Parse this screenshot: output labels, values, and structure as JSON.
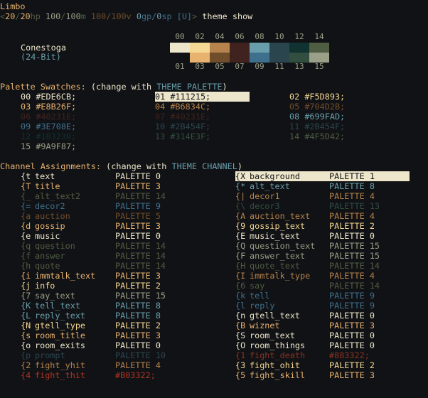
{
  "header": {
    "zone": "Limbo",
    "prompt": {
      "hp": "20",
      "hp_max": "20",
      "mv": "100",
      "mv_max": "100",
      "v": "100",
      "v_max": "100",
      "gp": "0",
      "sp": "0",
      "flag": "[U]",
      "command": "theme show"
    }
  },
  "theme": {
    "name": "Conestoga",
    "depth": "(24-Bit)",
    "top_indices": [
      "00",
      "02",
      "04",
      "06",
      "08",
      "10",
      "12",
      "14"
    ],
    "bottom_indices": [
      "01",
      "03",
      "05",
      "07",
      "09",
      "11",
      "13",
      "15"
    ],
    "top_colors": [
      "#EDE6CB",
      "#F5D893",
      "#B6834C",
      "#40231E",
      "#699FAD",
      "#2B454F",
      "#103230",
      "#4F5D42"
    ],
    "bottom_colors": [
      "#111215",
      "#E8B26F",
      "#704D2B",
      "#40231E",
      "#3E708E",
      "#2B454F",
      "#314E3F",
      "#9A9F87"
    ]
  },
  "palette": {
    "heading": "Palette Swatches:",
    "hint_pre": "(change with ",
    "hint_cmd": "THEME PALETTE",
    "hint_post": ")",
    "entries": [
      {
        "idx": "00",
        "hex": "#EDE6CB;"
      },
      {
        "idx": "01",
        "hex": "#111215;"
      },
      {
        "idx": "02",
        "hex": "#F5D893;"
      },
      {
        "idx": "03",
        "hex": "#E8B26F;"
      },
      {
        "idx": "04",
        "hex": "#B6834C;"
      },
      {
        "idx": "05",
        "hex": "#704D2B;"
      },
      {
        "idx": "06",
        "hex": "#40231E;"
      },
      {
        "idx": "07",
        "hex": "#40231E;"
      },
      {
        "idx": "08",
        "hex": "#699FAD;"
      },
      {
        "idx": "09",
        "hex": "#3E708E;"
      },
      {
        "idx": "10",
        "hex": "#2B454F;"
      },
      {
        "idx": "11",
        "hex": "#2B454F;"
      },
      {
        "idx": "12",
        "hex": "#103230;"
      },
      {
        "idx": "13",
        "hex": "#314E3F;"
      },
      {
        "idx": "14",
        "hex": "#4F5D42;"
      },
      {
        "idx": "15",
        "hex": "#9A9F87;"
      }
    ]
  },
  "channels": {
    "heading": "Channel Assignments:",
    "hint_pre": "(change with ",
    "hint_cmd": "THEME CHANNEL",
    "hint_post": ")",
    "left": [
      {
        "code": "{t",
        "name": "text",
        "val": "PALETTE 0",
        "c": 0
      },
      {
        "code": "{T",
        "name": "title",
        "val": "PALETTE 3",
        "c": 3
      },
      {
        "code": "{_",
        "name": "alt_text2",
        "val": "PALETTE 14",
        "c": 14
      },
      {
        "code": "{=",
        "name": "decor2",
        "val": "PALETTE 9",
        "c": 9
      },
      {
        "code": "{a",
        "name": "auction",
        "val": "PALETTE 5",
        "c": 5
      },
      {
        "code": "{d",
        "name": "gossip",
        "val": "PALETTE 3",
        "c": 3
      },
      {
        "code": "{e",
        "name": "music",
        "val": "PALETTE 0",
        "c": 0
      },
      {
        "code": "{q",
        "name": "question",
        "val": "PALETTE 14",
        "c": 14
      },
      {
        "code": "{f",
        "name": "answer",
        "val": "PALETTE 14",
        "c": 14
      },
      {
        "code": "{h",
        "name": "quote",
        "val": "PALETTE 14",
        "c": 14
      },
      {
        "code": "{i",
        "name": "immtalk_text",
        "val": "PALETTE 3",
        "c": 3
      },
      {
        "code": "{j",
        "name": "info",
        "val": "PALETTE 2",
        "c": 2
      },
      {
        "code": "{7",
        "name": "say_text",
        "val": "PALETTE 15",
        "c": 15
      },
      {
        "code": "{K",
        "name": "tell_text",
        "val": "PALETTE 8",
        "c": 8
      },
      {
        "code": "{L",
        "name": "reply_text",
        "val": "PALETTE 8",
        "c": 8
      },
      {
        "code": "{N",
        "name": "gtell_type",
        "val": "PALETTE 2",
        "c": 2
      },
      {
        "code": "{s",
        "name": "room_title",
        "val": "PALETTE 3",
        "c": 3
      },
      {
        "code": "{o",
        "name": "room_exits",
        "val": "PALETTE 0",
        "c": 0
      },
      {
        "code": "{p",
        "name": "prompt",
        "val": "PALETTE 10",
        "c": 10
      },
      {
        "code": "{2",
        "name": "fight_yhit",
        "val": "PALETTE 4",
        "c": 4
      },
      {
        "code": "{4",
        "name": "fight_thit",
        "val": "#B03322;",
        "c": "red"
      }
    ],
    "right": [
      {
        "code": "{X",
        "name": "background",
        "val": "PALETTE 1",
        "c": "hl"
      },
      {
        "code": "{*",
        "name": "alt_text",
        "val": "PALETTE 8",
        "c": 8
      },
      {
        "code": "{|",
        "name": "decor1",
        "val": "PALETTE 4",
        "c": 4
      },
      {
        "code": "{\\",
        "name": "decor3",
        "val": "PALETTE 13",
        "c": 13
      },
      {
        "code": "{A",
        "name": "auction_text",
        "val": "PALETTE 4",
        "c": 4
      },
      {
        "code": "{9",
        "name": "gossip_text",
        "val": "PALETTE 2",
        "c": 2
      },
      {
        "code": "{E",
        "name": "music_text",
        "val": "PALETTE 0",
        "c": 0
      },
      {
        "code": "{Q",
        "name": "question_text",
        "val": "PALETTE 15",
        "c": 15
      },
      {
        "code": "{F",
        "name": "answer_text",
        "val": "PALETTE 15",
        "c": 15
      },
      {
        "code": "{H",
        "name": "quote_text",
        "val": "PALETTE 14",
        "c": 14
      },
      {
        "code": "{I",
        "name": "immtalk_type",
        "val": "PALETTE 4",
        "c": 4
      },
      {
        "code": "{6",
        "name": "say",
        "val": "PALETTE 14",
        "c": 14
      },
      {
        "code": "{k",
        "name": "tell",
        "val": "PALETTE 9",
        "c": 9
      },
      {
        "code": "{l",
        "name": "reply",
        "val": "PALETTE 9",
        "c": 9
      },
      {
        "code": "{n",
        "name": "gtell_text",
        "val": "PALETTE 0",
        "c": 0
      },
      {
        "code": "{B",
        "name": "wiznet",
        "val": "PALETTE 3",
        "c": 3
      },
      {
        "code": "{S",
        "name": "room_text",
        "val": "PALETTE 0",
        "c": 0
      },
      {
        "code": "{O",
        "name": "room_things",
        "val": "PALETTE 0",
        "c": 0
      },
      {
        "code": "{1",
        "name": "fight_death",
        "val": "#883322;",
        "c": "red2"
      },
      {
        "code": "{3",
        "name": "fight_ohit",
        "val": "PALETTE 2",
        "c": 2
      },
      {
        "code": "{5",
        "name": "fight_skill",
        "val": "PALETTE 3",
        "c": 3
      }
    ]
  },
  "colors": {
    "red": "#B03322",
    "red2": "#883322"
  }
}
